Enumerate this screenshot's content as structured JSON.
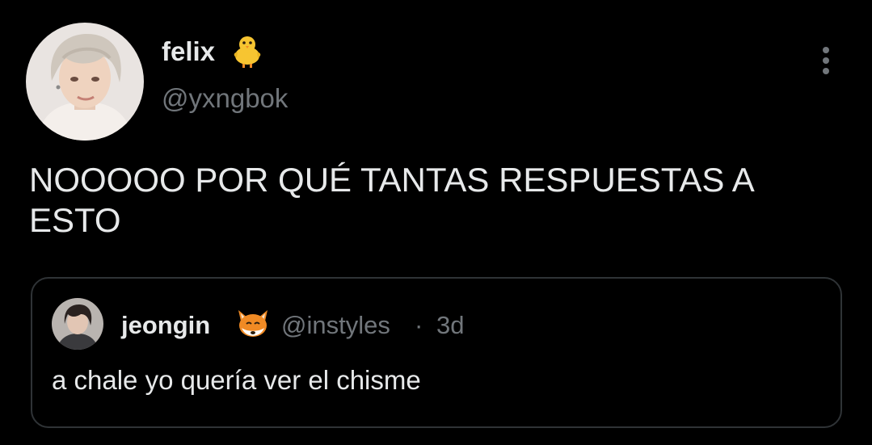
{
  "tweet": {
    "author": {
      "display_name": "felix",
      "emoji_icon": "baby-chick-emoji",
      "handle": "@yxngbok",
      "avatar_icon": "profile-photo"
    },
    "text": "NOOOOO POR QUÉ TANTAS RESPUESTAS A ESTO",
    "more_icon": "vertical-ellipsis-icon"
  },
  "quote": {
    "author": {
      "display_name": "jeongin",
      "emoji_icon": "fox-face-emoji",
      "handle": "@instyles",
      "avatar_icon": "profile-photo"
    },
    "separator": "·",
    "time": "3d",
    "text": "a chale yo quería ver el chisme"
  },
  "colors": {
    "background": "#000000",
    "primary_text": "#e7e9ea",
    "secondary_text": "#71767b",
    "card_border": "#2f3336"
  }
}
